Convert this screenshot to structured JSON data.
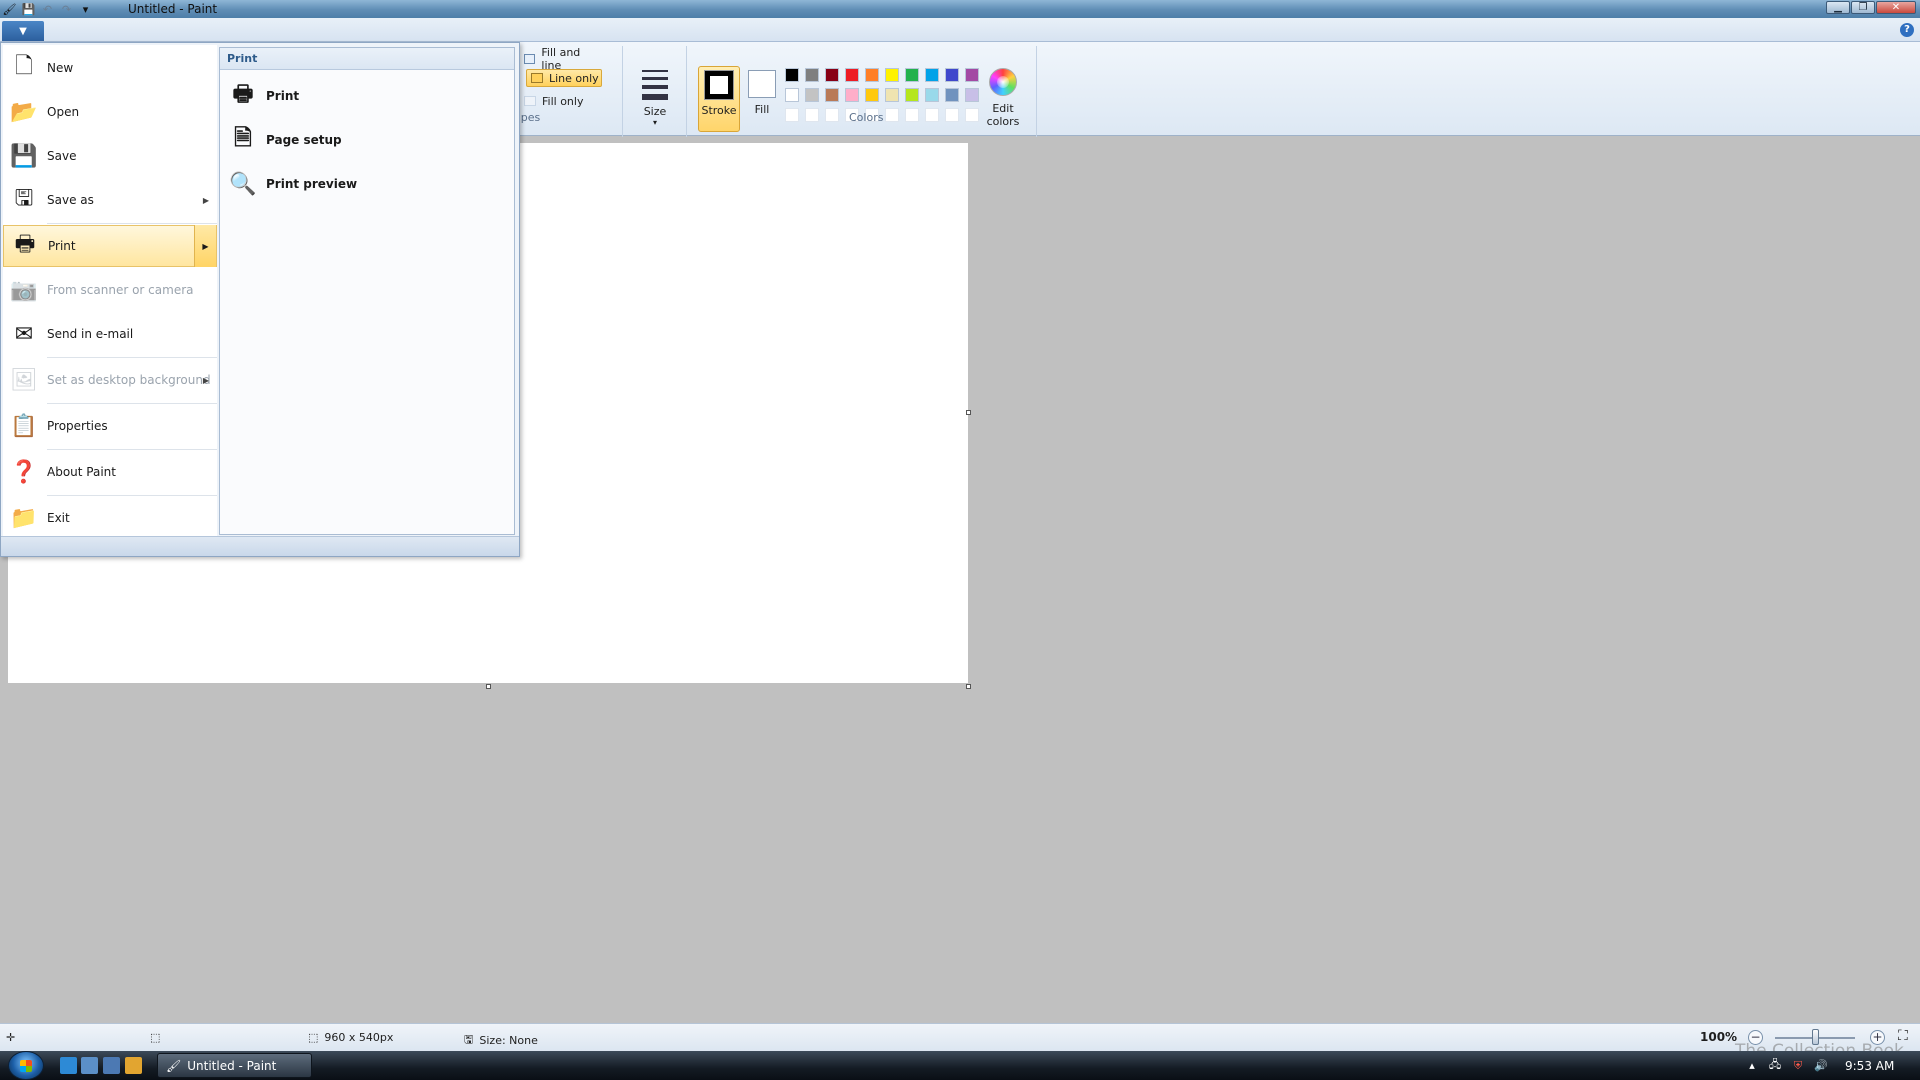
{
  "window": {
    "title": "Untitled - Paint"
  },
  "ribbon": {
    "shape_options": [
      "Fill and line",
      "Line only",
      "Fill only"
    ],
    "shapes_group_label": "apes",
    "size_label": "Size",
    "stroke_label": "Stroke",
    "fill_label": "Fill",
    "colors_group_label": "Colors",
    "edit_colors_label_1": "Edit",
    "edit_colors_label_2": "colors",
    "palette_row1": [
      "#000000",
      "#7f7f7f",
      "#880015",
      "#ed1c24",
      "#ff7f27",
      "#fff200",
      "#22b14c",
      "#00a2e8",
      "#3f48cc",
      "#a349a4"
    ],
    "palette_row2": [
      "#ffffff",
      "#c3c3c3",
      "#b97a57",
      "#ffaec9",
      "#ffc90e",
      "#efe4b0",
      "#b5e61d",
      "#99d9ea",
      "#7092be",
      "#c8bfe7"
    ]
  },
  "app_menu": {
    "items": [
      {
        "label": "New",
        "icon": "new-page-icon",
        "disabled": false,
        "submenu": false
      },
      {
        "label": "Open",
        "icon": "open-folder-icon",
        "disabled": false,
        "submenu": false
      },
      {
        "label": "Save",
        "icon": "save-disk-icon",
        "disabled": false,
        "submenu": false
      },
      {
        "label": "Save as",
        "icon": "save-as-icon",
        "disabled": false,
        "submenu": true
      },
      {
        "label": "Print",
        "icon": "printer-icon",
        "disabled": false,
        "submenu": true
      },
      {
        "label": "From scanner or camera",
        "icon": "scanner-icon",
        "disabled": true,
        "submenu": false
      },
      {
        "label": "Send in e-mail",
        "icon": "email-icon",
        "disabled": false,
        "submenu": false
      },
      {
        "label": "Set as desktop background",
        "icon": "desktop-background-icon",
        "disabled": true,
        "submenu": true
      },
      {
        "label": "Properties",
        "icon": "properties-icon",
        "disabled": false,
        "submenu": false
      },
      {
        "label": "About Paint",
        "icon": "help-icon",
        "disabled": false,
        "submenu": false
      },
      {
        "label": "Exit",
        "icon": "exit-icon",
        "disabled": false,
        "submenu": false
      }
    ],
    "submenu": {
      "header": "Print",
      "items": [
        {
          "label": "Print",
          "icon": "printer-icon"
        },
        {
          "label": "Page setup",
          "icon": "page-setup-icon"
        },
        {
          "label": "Print preview",
          "icon": "print-preview-icon"
        }
      ]
    }
  },
  "status": {
    "canvas_size": "960 x 540px",
    "selection_size": "Size: None",
    "zoom": "100%"
  },
  "taskbar": {
    "task_label": "Untitled - Paint",
    "clock": "9:53 AM"
  },
  "watermark": "The Collection Book"
}
